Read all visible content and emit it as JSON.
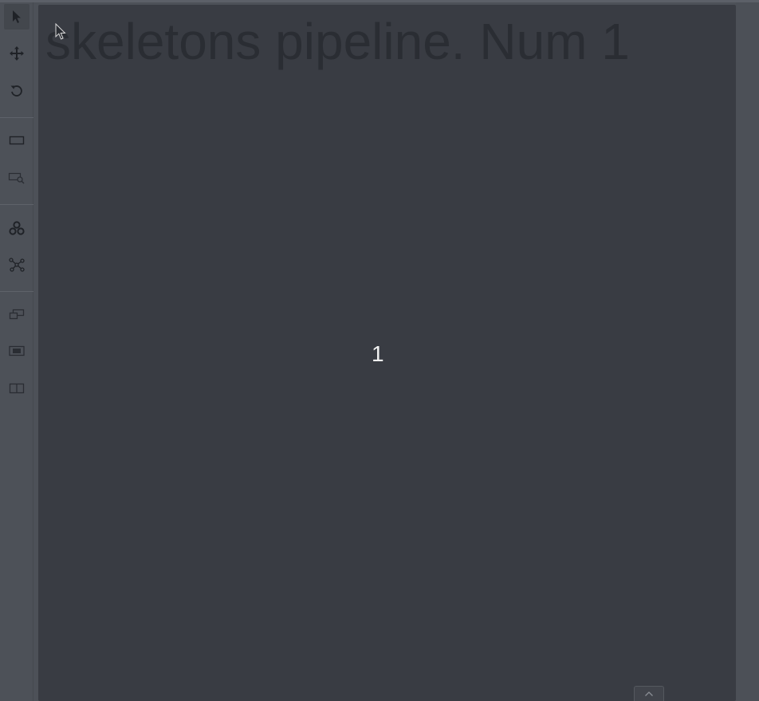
{
  "canvas": {
    "title": "skeletons pipeline. Num 1",
    "frame_number": "1"
  },
  "toolbar": {
    "tools": [
      {
        "icon": "cursor-icon",
        "active": true
      },
      {
        "icon": "move-icon"
      },
      {
        "icon": "rotate-icon"
      },
      {
        "icon": "fit-image-icon"
      },
      {
        "icon": "zoom-region-icon"
      },
      {
        "icon": "opencv-icon"
      },
      {
        "icon": "skeleton-icon"
      },
      {
        "icon": "group-icon"
      },
      {
        "icon": "merge-icon"
      },
      {
        "icon": "split-icon"
      }
    ]
  },
  "colors": {
    "background": "#4d5158",
    "canvas": "#393c43",
    "title_text": "#2a2d33",
    "frame_number_text": "#f2f2f2",
    "icon": "#1f2227"
  }
}
